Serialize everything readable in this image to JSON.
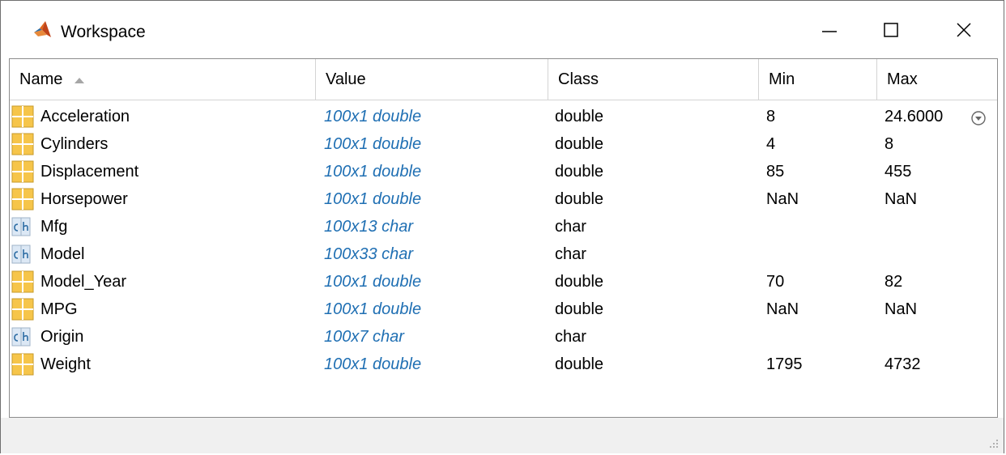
{
  "window": {
    "title": "Workspace",
    "minimize_icon": "minimize-icon",
    "maximize_icon": "maximize-icon",
    "close_icon": "close-icon"
  },
  "columns": [
    {
      "label": "Name",
      "sorted": "ascending"
    },
    {
      "label": "Value"
    },
    {
      "label": "Class"
    },
    {
      "label": "Min"
    },
    {
      "label": "Max"
    }
  ],
  "rows": [
    {
      "icon": "matrix-icon",
      "name": "Acceleration",
      "value": "100x1 double",
      "class": "double",
      "min": "8",
      "max": "24.6000"
    },
    {
      "icon": "matrix-icon",
      "name": "Cylinders",
      "value": "100x1 double",
      "class": "double",
      "min": "4",
      "max": "8"
    },
    {
      "icon": "matrix-icon",
      "name": "Displacement",
      "value": "100x1 double",
      "class": "double",
      "min": "85",
      "max": "455"
    },
    {
      "icon": "matrix-icon",
      "name": "Horsepower",
      "value": "100x1 double",
      "class": "double",
      "min": "NaN",
      "max": "NaN"
    },
    {
      "icon": "char-icon",
      "name": "Mfg",
      "value": "100x13 char",
      "class": "char",
      "min": "",
      "max": ""
    },
    {
      "icon": "char-icon",
      "name": "Model",
      "value": "100x33 char",
      "class": "char",
      "min": "",
      "max": ""
    },
    {
      "icon": "matrix-icon",
      "name": "Model_Year",
      "value": "100x1 double",
      "class": "double",
      "min": "70",
      "max": "82"
    },
    {
      "icon": "matrix-icon",
      "name": "MPG",
      "value": "100x1 double",
      "class": "double",
      "min": "NaN",
      "max": "NaN"
    },
    {
      "icon": "char-icon",
      "name": "Origin",
      "value": "100x7 char",
      "class": "char",
      "min": "",
      "max": ""
    },
    {
      "icon": "matrix-icon",
      "name": "Weight",
      "value": "100x1 double",
      "class": "double",
      "min": "1795",
      "max": "4732"
    }
  ],
  "colors": {
    "value_text": "#1f6fb3",
    "matrix_icon_fill": "#f6c54a",
    "char_icon_fill": "#dce8f5"
  }
}
